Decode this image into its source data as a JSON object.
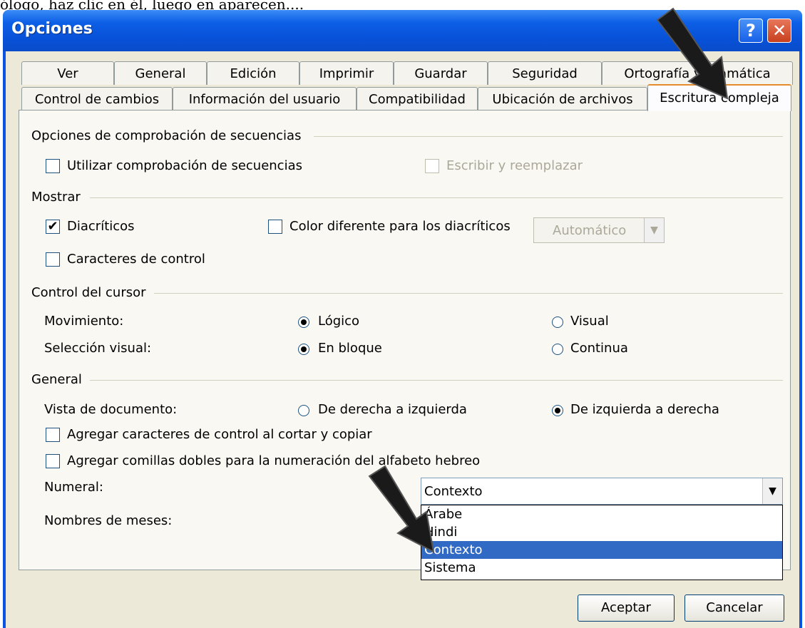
{
  "background_text": "ólogo, haz clic en él, luego en aparecen....",
  "window": {
    "title": "Opciones",
    "help_glyph": "?",
    "close_glyph": "✕"
  },
  "tabs": {
    "row1": [
      "Ver",
      "General",
      "Edición",
      "Imprimir",
      "Guardar",
      "Seguridad",
      "Ortografía y gramática"
    ],
    "row2": [
      "Control de cambios",
      "Información del usuario",
      "Compatibilidad",
      "Ubicación de archivos",
      "Escritura compleja"
    ],
    "active": "Escritura compleja"
  },
  "sections": {
    "secuencias": {
      "title": "Opciones de comprobación de secuencias",
      "utilizar_label": "Utilizar comprobación de secuencias",
      "escribir_label": "Escribir y reemplazar"
    },
    "mostrar": {
      "title": "Mostrar",
      "diacriticos_label": "Diacríticos",
      "color_label": "Color diferente para los diacríticos",
      "color_value": "Automático",
      "caracteres_label": "Caracteres de control"
    },
    "cursor": {
      "title": "Control del cursor",
      "movimiento_label": "Movimiento:",
      "logico_label": "Lógico",
      "visual_label": "Visual",
      "seleccion_label": "Selección visual:",
      "bloque_label": "En bloque",
      "continua_label": "Continua"
    },
    "general": {
      "title": "General",
      "vista_label": "Vista de documento:",
      "der_izq_label": "De derecha a izquierda",
      "izq_der_label": "De izquierda a derecha",
      "agregar_control_label": "Agregar caracteres de control al cortar y copiar",
      "agregar_comillas_label": "Agregar comillas dobles para la numeración del alfabeto hebreo",
      "numeral_label": "Numeral:",
      "numeral_value": "Contexto",
      "meses_label": "Nombres de meses:",
      "numeral_options": [
        "Árabe",
        "Hindi",
        "Contexto",
        "Sistema"
      ],
      "numeral_selected": "Contexto"
    }
  },
  "state": {
    "utilizar_checked": false,
    "escribir_checked": false,
    "diacriticos_checked": true,
    "color_checked": false,
    "caracteres_checked": false,
    "movimiento": "Lógico",
    "seleccion": "En bloque",
    "vista": "De izquierda a derecha",
    "agregar_control_checked": false,
    "agregar_comillas_checked": false
  },
  "buttons": {
    "aceptar": "Aceptar",
    "cancelar": "Cancelar"
  },
  "colors": {
    "titlebar": "#0751d8",
    "selection": "#316ac5",
    "tab_accent": "#e68b2c"
  }
}
